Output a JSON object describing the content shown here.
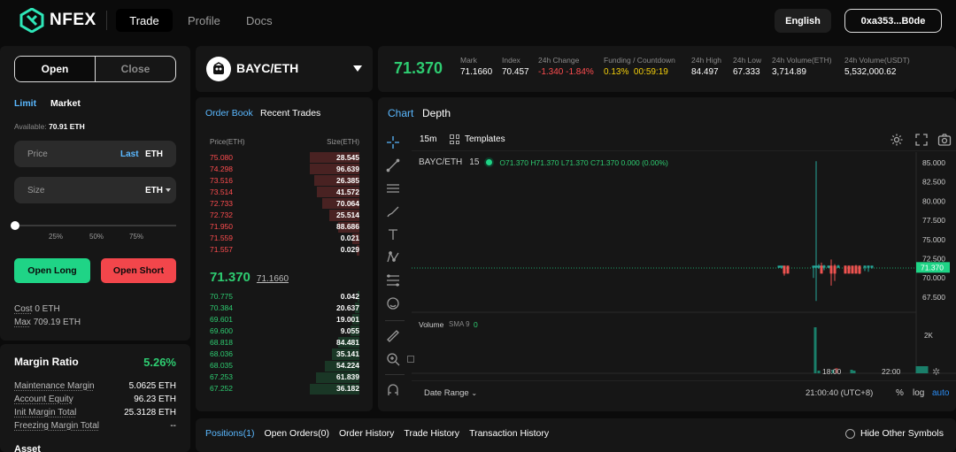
{
  "header": {
    "logo_text": "NFEX",
    "nav": [
      "Trade",
      "Profile",
      "Docs"
    ],
    "language": "English",
    "wallet": "0xa353...B0de"
  },
  "order_form": {
    "tabs": [
      "Open",
      "Close"
    ],
    "order_types": [
      "Limit",
      "Market"
    ],
    "available_label": "Available:",
    "available_value": "70.91 ETH",
    "price_placeholder": "Price",
    "price_last": "Last",
    "price_unit": "ETH",
    "size_placeholder": "Size",
    "size_unit": "ETH",
    "slider_marks": [
      "25%",
      "50%",
      "75%"
    ],
    "slider_value": 0,
    "open_long": "Open Long",
    "open_short": "Open Short",
    "cost_label": "Cost",
    "cost_value": "0 ETH",
    "max_label": "Max",
    "max_value": "709.19 ETH"
  },
  "margin": {
    "title": "Margin Ratio",
    "ratio": "5.26%",
    "rows": [
      {
        "label": "Maintenance Margin",
        "value": "5.0625 ETH"
      },
      {
        "label": "Account Equity",
        "value": "96.23 ETH"
      },
      {
        "label": "Init Margin Total",
        "value": "25.3128 ETH"
      },
      {
        "label": "Freezing Margin Total",
        "value": "--"
      }
    ],
    "asset_label": "Asset"
  },
  "market": {
    "pair": "BAYC/ETH",
    "last_price": "71.370",
    "stats": [
      {
        "label": "Mark",
        "value": "71.1660",
        "color": "#ffffff"
      },
      {
        "label": "Index",
        "value": "70.457",
        "color": "#ffffff"
      },
      {
        "label": "24h Change",
        "value": "-1.340 -1.84%",
        "color": "#ff4d4f"
      },
      {
        "label": "Funding / Countdown",
        "value": "0.13%  00:59:19",
        "color": "#f5d00b"
      },
      {
        "label": "24h High",
        "value": "84.497",
        "color": "#ffffff"
      },
      {
        "label": "24h Low",
        "value": "67.333",
        "color": "#ffffff"
      },
      {
        "label": "24h Volume(ETH)",
        "value": "3,714.89",
        "color": "#ffffff"
      },
      {
        "label": "24h Volume(USDT)",
        "value": "5,532,000.62",
        "color": "#ffffff"
      }
    ]
  },
  "orderbook": {
    "tabs": [
      "Order Book",
      "Recent Trades"
    ],
    "col_price": "Price(ETH)",
    "col_size": "Size(ETH)",
    "asks": [
      {
        "price": "75.080",
        "size": "28.545",
        "depth": 0.33
      },
      {
        "price": "74.298",
        "size": "96.639",
        "depth": 0.33
      },
      {
        "price": "73.516",
        "size": "26.385",
        "depth": 0.3
      },
      {
        "price": "73.514",
        "size": "41.572",
        "depth": 0.28
      },
      {
        "price": "72.733",
        "size": "70.064",
        "depth": 0.25
      },
      {
        "price": "72.732",
        "size": "25.514",
        "depth": 0.2
      },
      {
        "price": "71.950",
        "size": "88.686",
        "depth": 0.14
      },
      {
        "price": "71.559",
        "size": "0.021",
        "depth": 0.05
      },
      {
        "price": "71.557",
        "size": "0.029",
        "depth": 0.02
      }
    ],
    "mid_price": "71.370",
    "mid_mark": "71.1660",
    "bids": [
      {
        "price": "70.775",
        "size": "0.042",
        "depth": 0.01
      },
      {
        "price": "70.384",
        "size": "20.637",
        "depth": 0.03
      },
      {
        "price": "69.601",
        "size": "19.001",
        "depth": 0.05
      },
      {
        "price": "69.600",
        "size": "9.055",
        "depth": 0.06
      },
      {
        "price": "68.818",
        "size": "84.481",
        "depth": 0.14
      },
      {
        "price": "68.036",
        "size": "35.141",
        "depth": 0.18
      },
      {
        "price": "68.035",
        "size": "54.224",
        "depth": 0.23
      },
      {
        "price": "67.253",
        "size": "61.839",
        "depth": 0.29
      },
      {
        "price": "67.252",
        "size": "36.182",
        "depth": 0.33
      }
    ]
  },
  "chart": {
    "tabs": [
      "Chart",
      "Depth"
    ],
    "interval": "15m",
    "templates": "Templates",
    "symbol": "BAYC/ETH",
    "symbol_interval": "15",
    "ohlc": "O71.370 H71.370 L71.370 C71.370 0.000 (0.00%)",
    "price_ticks": [
      "85.000",
      "82.500",
      "80.000",
      "77.500",
      "75.000",
      "72.500",
      "70.000",
      "67.500"
    ],
    "current_price_tag": "71.370",
    "volume_label": "Volume",
    "volume_indicator": "SMA 9",
    "volume_value": "0",
    "volume_tick": "2K",
    "time_ticks": [
      "18:00",
      "22:00"
    ],
    "date_range": "Date Range",
    "clock": "21:00:40 (UTC+8)",
    "scale_pct": "%",
    "scale_log": "log",
    "scale_auto": "auto"
  },
  "bottom": {
    "tabs": [
      "Positions(1)",
      "Open Orders(0)",
      "Order History",
      "Trade History",
      "Transaction History"
    ],
    "hide_other": "Hide Other Symbols"
  },
  "colors": {
    "green": "#2ecc71",
    "red": "#ff4d4f",
    "accent_green": "#1fd486",
    "accent_red": "#f2464b"
  }
}
